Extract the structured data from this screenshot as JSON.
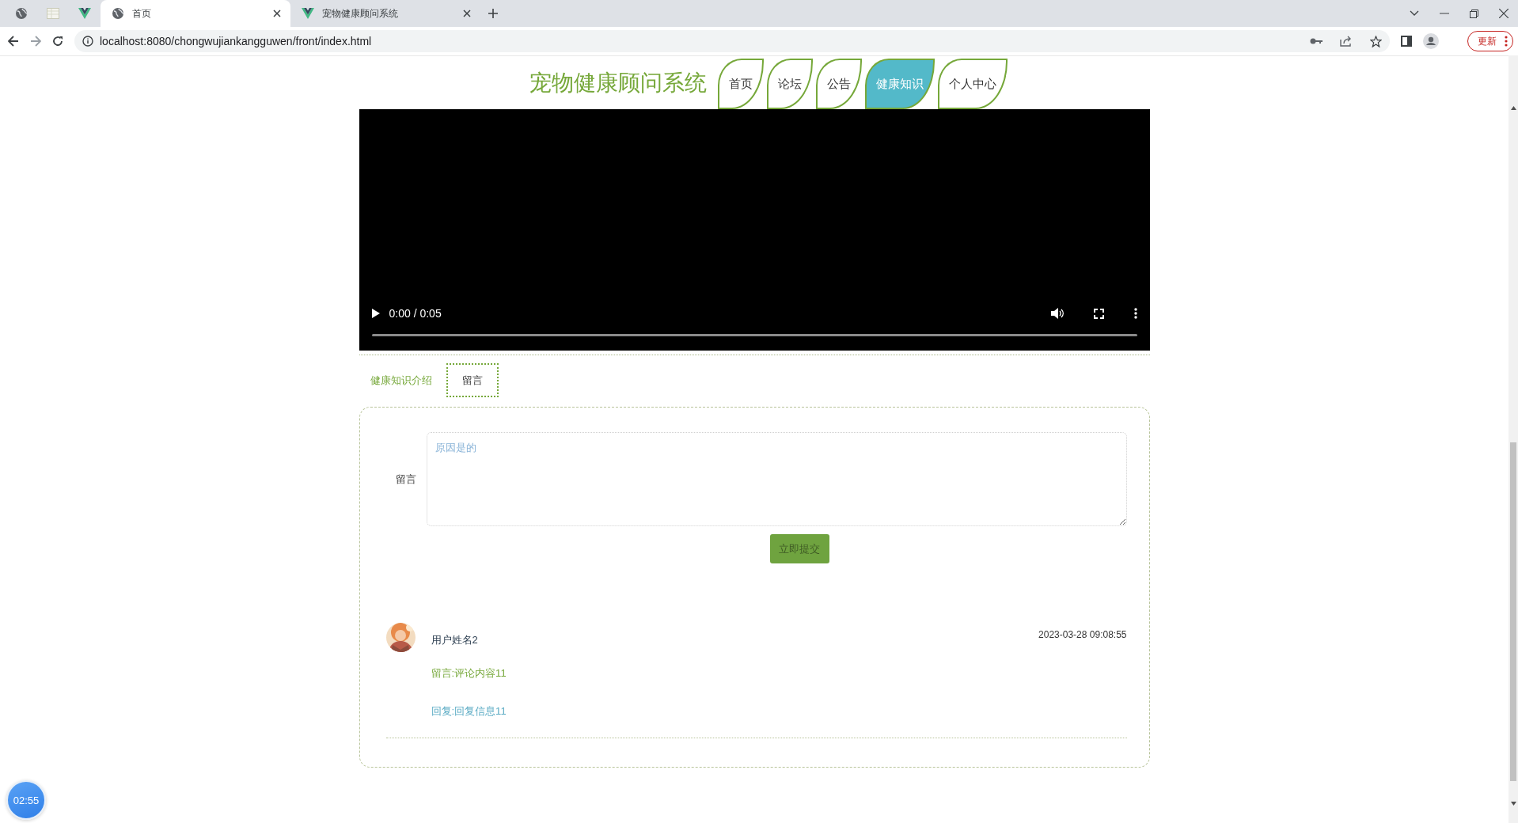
{
  "browser": {
    "tabs": [
      {
        "kind": "globe",
        "selected": false
      },
      {
        "kind": "sheet",
        "selected": false
      },
      {
        "kind": "vue",
        "selected": false
      },
      {
        "kind": "globe",
        "title": "首页",
        "selected": true
      },
      {
        "kind": "vue",
        "title": "宠物健康顾问系统",
        "selected": false
      }
    ],
    "address": "localhost:8080/chongwujiankangguwen/front/index.html",
    "update_button": "更新"
  },
  "site_title": "宠物健康顾问系统",
  "nav": [
    {
      "label": "首页",
      "selected": false
    },
    {
      "label": "论坛",
      "selected": false
    },
    {
      "label": "公告",
      "selected": false
    },
    {
      "label": "健康知识",
      "selected": true
    },
    {
      "label": "个人中心",
      "selected": false
    }
  ],
  "video": {
    "time": "0:00 / 0:05",
    "level": 0
  },
  "content_tabs": [
    {
      "label": "健康知识介绍",
      "selected": false
    },
    {
      "label": "留言",
      "selected": true
    }
  ],
  "form": {
    "label": "留言",
    "value": "原因是的",
    "submit": "立即提交"
  },
  "comments": [
    {
      "name": "用户姓名2",
      "time": "2023-03-28 09:08:55",
      "message": "留言:评论内容11",
      "reply": "回复:回复信息11"
    }
  ],
  "timer": "02:55"
}
